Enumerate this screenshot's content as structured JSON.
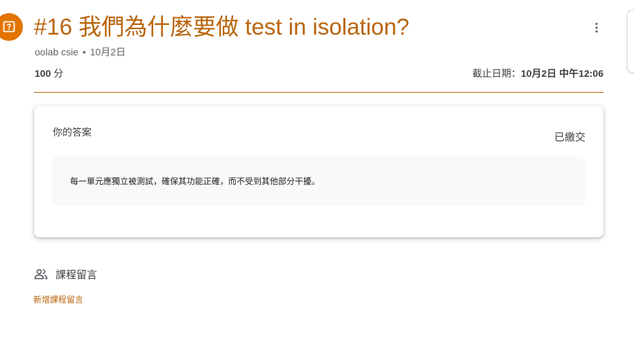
{
  "assignment": {
    "icon": "assignment-question-icon",
    "title": "#16  我們為什麼要做 test in isolation?",
    "author": "oolab csie",
    "separator": "•",
    "posted_date": "10月2日",
    "points_value": "100",
    "points_unit": "分",
    "due_label": "截止日期：",
    "due_date": "10月2日 中午12:06",
    "accent_color": "#b9640b",
    "icon_color": "#e37400"
  },
  "your_work": {
    "heading": "你的答案",
    "status": "已繳交",
    "answer_text": "每一單元應獨立被測試，確保其功能正確，而不受到其他部分干擾。"
  },
  "class_comments": {
    "icon": "people-icon",
    "label": "課程留言",
    "add_link": "新增課程留言"
  }
}
